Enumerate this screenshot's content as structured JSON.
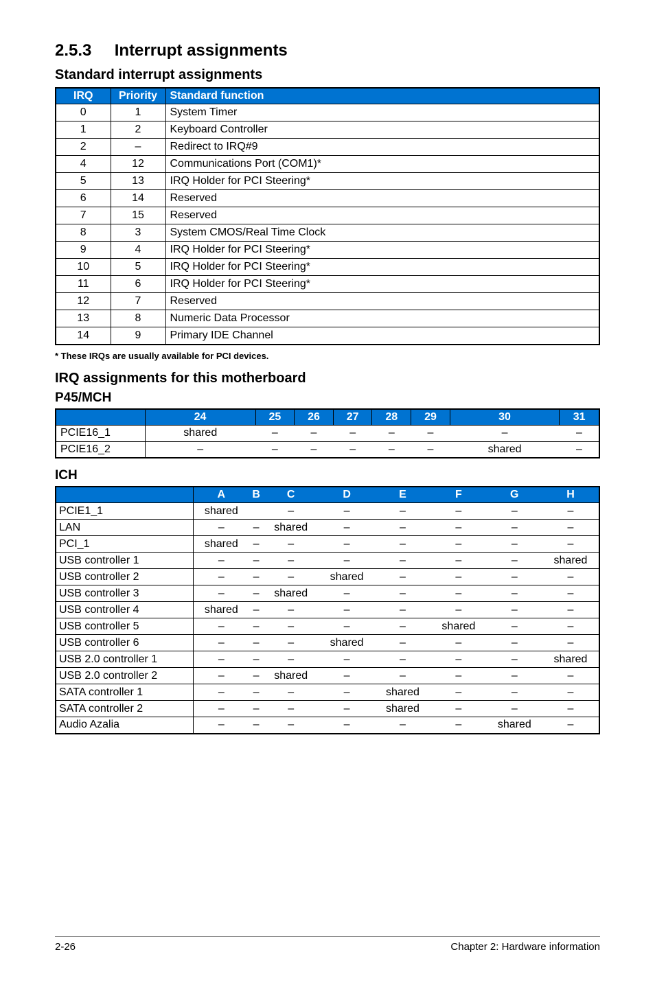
{
  "section_number": "2.5.3",
  "section_title": "Interrupt assignments",
  "standard_title": "Standard interrupt assignments",
  "standard_headers": [
    "IRQ",
    "Priority",
    "Standard function"
  ],
  "standard_rows": [
    {
      "irq": "0",
      "priority": "1",
      "func": "System Timer"
    },
    {
      "irq": "1",
      "priority": "2",
      "func": "Keyboard Controller"
    },
    {
      "irq": "2",
      "priority": "–",
      "func": "Redirect to IRQ#9"
    },
    {
      "irq": "4",
      "priority": "12",
      "func": "Communications Port (COM1)*"
    },
    {
      "irq": "5",
      "priority": "13",
      "func": "IRQ Holder for PCI Steering*"
    },
    {
      "irq": "6",
      "priority": "14",
      "func": "Reserved"
    },
    {
      "irq": "7",
      "priority": "15",
      "func": "Reserved"
    },
    {
      "irq": "8",
      "priority": "3",
      "func": "System CMOS/Real Time Clock"
    },
    {
      "irq": "9",
      "priority": "4",
      "func": "IRQ Holder for PCI Steering*"
    },
    {
      "irq": "10",
      "priority": "5",
      "func": "IRQ Holder for PCI Steering*"
    },
    {
      "irq": "11",
      "priority": "6",
      "func": "IRQ Holder for PCI Steering*"
    },
    {
      "irq": "12",
      "priority": "7",
      "func": "Reserved"
    },
    {
      "irq": "13",
      "priority": "8",
      "func": "Numeric Data Processor"
    },
    {
      "irq": "14",
      "priority": "9",
      "func": "Primary IDE Channel"
    }
  ],
  "footnote": "* These IRQs are usually available for PCI devices.",
  "irq_mb_title": "IRQ assignments for this motherboard",
  "mch_title": "P45/MCH",
  "mch_headers": [
    "",
    "24",
    "25",
    "26",
    "27",
    "28",
    "29",
    "30",
    "31"
  ],
  "mch_rows": [
    {
      "label": "PCIE16_1",
      "cells": [
        "shared",
        "–",
        "–",
        "–",
        "–",
        "–",
        "–",
        "–"
      ]
    },
    {
      "label": "PCIE16_2",
      "cells": [
        "–",
        "–",
        "–",
        "–",
        "–",
        "–",
        "shared",
        "–"
      ]
    }
  ],
  "ich_title": "ICH",
  "ich_headers": [
    "",
    "A",
    "B",
    "C",
    "D",
    "E",
    "F",
    "G",
    "H"
  ],
  "ich_rows": [
    {
      "label": "PCIE1_1",
      "cells": [
        "shared",
        "",
        "–",
        "–",
        "–",
        "–",
        "–",
        "–"
      ]
    },
    {
      "label": "LAN",
      "cells": [
        "–",
        "–",
        "shared",
        "–",
        "–",
        "–",
        "–",
        "–"
      ]
    },
    {
      "label": "PCI_1",
      "cells": [
        "shared",
        "–",
        "–",
        "–",
        "–",
        "–",
        "–",
        "–"
      ]
    },
    {
      "label": "USB controller 1",
      "cells": [
        "–",
        "–",
        "–",
        "–",
        "–",
        "–",
        "–",
        "shared"
      ]
    },
    {
      "label": "USB controller 2",
      "cells": [
        "–",
        "–",
        "–",
        "shared",
        "–",
        "–",
        "–",
        "–"
      ]
    },
    {
      "label": "USB controller 3",
      "cells": [
        "–",
        "–",
        "shared",
        "–",
        "–",
        "–",
        "–",
        "–"
      ]
    },
    {
      "label": "USB controller 4",
      "cells": [
        "shared",
        "–",
        "–",
        "–",
        "–",
        "–",
        "–",
        "–"
      ]
    },
    {
      "label": "USB controller 5",
      "cells": [
        "–",
        "–",
        "–",
        "–",
        "–",
        "shared",
        "–",
        "–"
      ]
    },
    {
      "label": "USB controller 6",
      "cells": [
        "–",
        "–",
        "–",
        "shared",
        "–",
        "–",
        "–",
        "–"
      ]
    },
    {
      "label": "USB 2.0 controller 1",
      "cells": [
        "–",
        "–",
        "–",
        "–",
        "–",
        "–",
        "–",
        "shared"
      ]
    },
    {
      "label": "USB 2.0 controller 2",
      "cells": [
        "–",
        "–",
        "shared",
        "–",
        "–",
        "–",
        "–",
        "–"
      ]
    },
    {
      "label": "SATA controller 1",
      "cells": [
        "–",
        "–",
        "–",
        "–",
        "shared",
        "–",
        "–",
        "–"
      ]
    },
    {
      "label": "SATA controller 2",
      "cells": [
        "–",
        "–",
        "–",
        "–",
        "shared",
        "–",
        "–",
        "–"
      ]
    },
    {
      "label": "Audio Azalia",
      "cells": [
        "–",
        "–",
        "–",
        "–",
        "–",
        "–",
        "shared",
        "–"
      ]
    }
  ],
  "footer_left": "2-26",
  "footer_right": "Chapter 2: Hardware information",
  "chart_data": {
    "type": "table",
    "tables": [
      {
        "name": "Standard interrupt assignments",
        "columns": [
          "IRQ",
          "Priority",
          "Standard function"
        ],
        "rows": [
          [
            "0",
            "1",
            "System Timer"
          ],
          [
            "1",
            "2",
            "Keyboard Controller"
          ],
          [
            "2",
            "–",
            "Redirect to IRQ#9"
          ],
          [
            "4",
            "12",
            "Communications Port (COM1)*"
          ],
          [
            "5",
            "13",
            "IRQ Holder for PCI Steering*"
          ],
          [
            "6",
            "14",
            "Reserved"
          ],
          [
            "7",
            "15",
            "Reserved"
          ],
          [
            "8",
            "3",
            "System CMOS/Real Time Clock"
          ],
          [
            "9",
            "4",
            "IRQ Holder for PCI Steering*"
          ],
          [
            "10",
            "5",
            "IRQ Holder for PCI Steering*"
          ],
          [
            "11",
            "6",
            "IRQ Holder for PCI Steering*"
          ],
          [
            "12",
            "7",
            "Reserved"
          ],
          [
            "13",
            "8",
            "Numeric Data Processor"
          ],
          [
            "14",
            "9",
            "Primary IDE Channel"
          ]
        ]
      },
      {
        "name": "P45/MCH",
        "columns": [
          "",
          "24",
          "25",
          "26",
          "27",
          "28",
          "29",
          "30",
          "31"
        ],
        "rows": [
          [
            "PCIE16_1",
            "shared",
            "–",
            "–",
            "–",
            "–",
            "–",
            "–",
            "–"
          ],
          [
            "PCIE16_2",
            "–",
            "–",
            "–",
            "–",
            "–",
            "–",
            "shared",
            "–"
          ]
        ]
      },
      {
        "name": "ICH",
        "columns": [
          "",
          "A",
          "B",
          "C",
          "D",
          "E",
          "F",
          "G",
          "H"
        ],
        "rows": [
          [
            "PCIE1_1",
            "shared",
            "",
            "–",
            "–",
            "–",
            "–",
            "–",
            "–"
          ],
          [
            "LAN",
            "–",
            "–",
            "shared",
            "–",
            "–",
            "–",
            "–",
            "–"
          ],
          [
            "PCI_1",
            "shared",
            "–",
            "–",
            "–",
            "–",
            "–",
            "–",
            "–"
          ],
          [
            "USB controller 1",
            "–",
            "–",
            "–",
            "–",
            "–",
            "–",
            "–",
            "shared"
          ],
          [
            "USB controller 2",
            "–",
            "–",
            "–",
            "shared",
            "–",
            "–",
            "–",
            "–"
          ],
          [
            "USB controller 3",
            "–",
            "–",
            "shared",
            "–",
            "–",
            "–",
            "–",
            "–"
          ],
          [
            "USB controller 4",
            "shared",
            "–",
            "–",
            "–",
            "–",
            "–",
            "–",
            "–"
          ],
          [
            "USB controller 5",
            "–",
            "–",
            "–",
            "–",
            "–",
            "shared",
            "–",
            "–"
          ],
          [
            "USB controller 6",
            "–",
            "–",
            "–",
            "shared",
            "–",
            "–",
            "–",
            "–"
          ],
          [
            "USB 2.0 controller 1",
            "–",
            "–",
            "–",
            "–",
            "–",
            "–",
            "–",
            "shared"
          ],
          [
            "USB 2.0 controller 2",
            "–",
            "–",
            "shared",
            "–",
            "–",
            "–",
            "–",
            "–"
          ],
          [
            "SATA controller 1",
            "–",
            "–",
            "–",
            "–",
            "shared",
            "–",
            "–",
            "–"
          ],
          [
            "SATA controller 2",
            "–",
            "–",
            "–",
            "–",
            "shared",
            "–",
            "–",
            "–"
          ],
          [
            "Audio Azalia",
            "–",
            "–",
            "–",
            "–",
            "–",
            "–",
            "shared",
            "–"
          ]
        ]
      }
    ]
  }
}
